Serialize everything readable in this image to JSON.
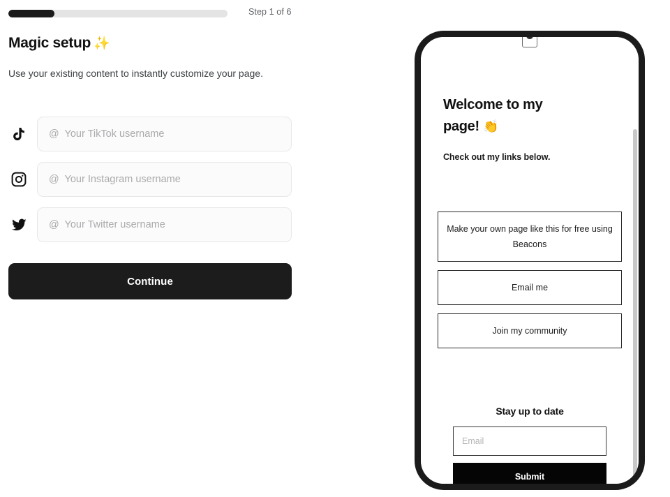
{
  "progress": {
    "step_label": "Step 1 of 6",
    "percent": 17,
    "fill_color": "#1a1a1a",
    "track_color": "#e4e4e4"
  },
  "setup": {
    "title": "Magic setup",
    "title_emoji": "✨",
    "subtitle": "Use your existing content to instantly customize your page.",
    "social_fields": [
      {
        "icon": "tiktok-icon",
        "placeholder": "@  Your TikTok username",
        "value": ""
      },
      {
        "icon": "instagram-icon",
        "placeholder": "@  Your Instagram username",
        "value": ""
      },
      {
        "icon": "twitter-icon",
        "placeholder": "@  Your Twitter username",
        "value": ""
      }
    ],
    "continue_label": "Continue"
  },
  "preview": {
    "bio_title": "Welcome to my page!",
    "bio_title_emoji": "👏",
    "bio_subtitle": "Check out my links below.",
    "links": [
      {
        "label": "Make your own page like this for free using Beacons"
      },
      {
        "label": "Email me"
      },
      {
        "label": "Join my community"
      }
    ],
    "newsletter": {
      "title": "Stay up to date",
      "email_placeholder": "Email",
      "email_value": "",
      "submit_label": "Submit"
    }
  }
}
